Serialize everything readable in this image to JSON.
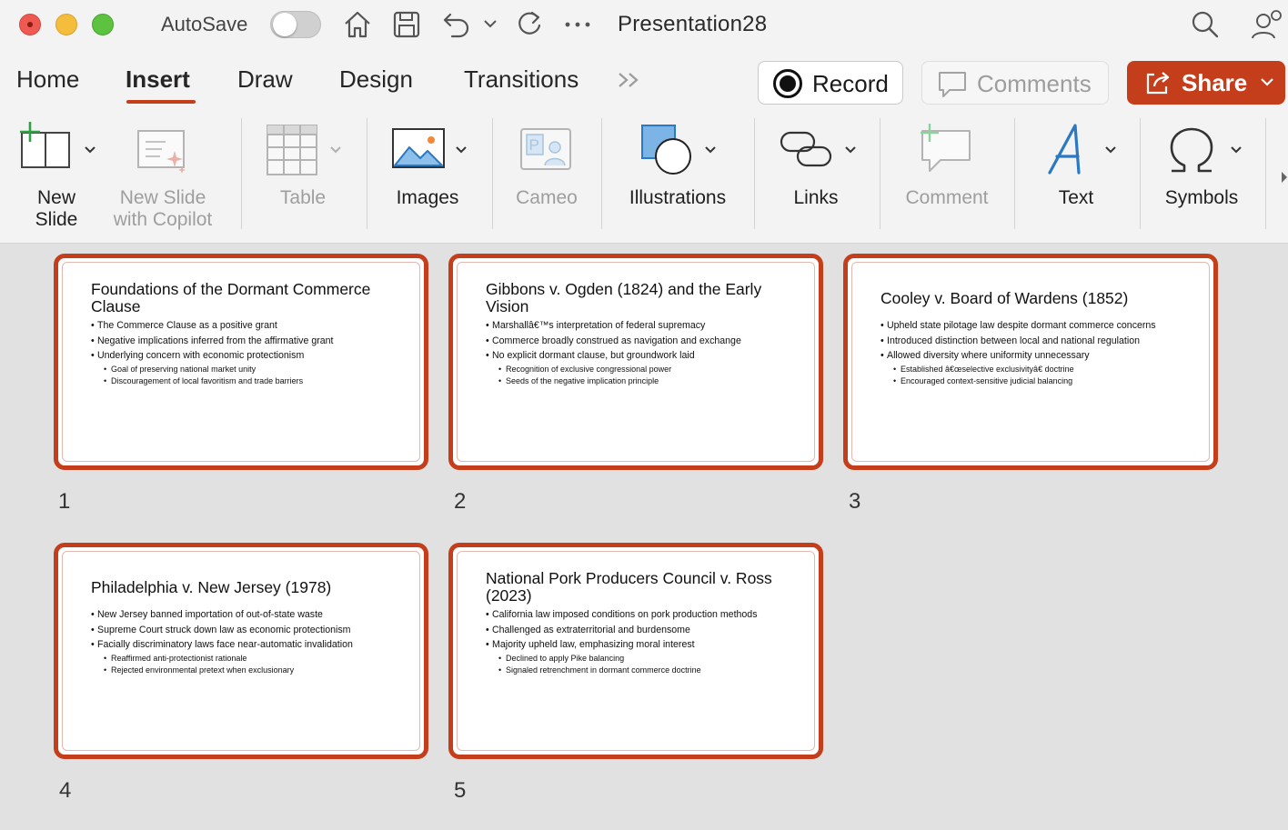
{
  "window": {
    "autosave_label": "AutoSave",
    "document_title": "Presentation28"
  },
  "tabs": [
    {
      "label": "Home"
    },
    {
      "label": "Insert",
      "active": true
    },
    {
      "label": "Draw"
    },
    {
      "label": "Design"
    },
    {
      "label": "Transitions"
    }
  ],
  "actions": {
    "record": "Record",
    "comments": "Comments",
    "share": "Share"
  },
  "ribbon": {
    "new_slide_line1": "New",
    "new_slide_line2": "Slide",
    "copilot_line1": "New Slide",
    "copilot_line2": "with Copilot",
    "table": "Table",
    "images": "Images",
    "cameo": "Cameo",
    "illustrations": "Illustrations",
    "links": "Links",
    "comment": "Comment",
    "text": "Text",
    "symbols": "Symbols"
  },
  "colors": {
    "accent": "#c43e1c",
    "ribbon_bg": "#f3f3f3",
    "canvas_bg": "#e1e1e1"
  },
  "slides": [
    {
      "number": "1",
      "title": "Foundations of the Dormant Commerce Clause",
      "bullets": [
        "The Commerce Clause as a positive grant",
        "Negative implications inferred from the affirmative grant",
        "Underlying concern with economic protectionism"
      ],
      "sub_bullets": [
        "Goal of preserving national market unity",
        "Discouragement of local favoritism and trade barriers"
      ]
    },
    {
      "number": "2",
      "title": "Gibbons v. Ogden (1824) and the Early Vision",
      "bullets": [
        "Marshallâ€™s interpretation of federal supremacy",
        "Commerce broadly construed as navigation and exchange",
        "No explicit dormant clause, but groundwork laid"
      ],
      "sub_bullets": [
        "Recognition of exclusive congressional power",
        "Seeds of the negative implication principle"
      ]
    },
    {
      "number": "3",
      "title": "Cooley v. Board of Wardens (1852)",
      "bullets": [
        "Upheld state pilotage law despite dormant commerce concerns",
        "Introduced distinction between local and national regulation",
        "Allowed diversity where uniformity unnecessary"
      ],
      "sub_bullets": [
        "Established â€œselective exclusivityâ€ doctrine",
        "Encouraged context-sensitive judicial balancing"
      ]
    },
    {
      "number": "4",
      "title": "Philadelphia v. New Jersey (1978)",
      "bullets": [
        "New Jersey banned importation of out-of-state waste",
        "Supreme Court struck down law as economic protectionism",
        "Facially discriminatory laws face near-automatic invalidation"
      ],
      "sub_bullets": [
        "Reaffirmed anti-protectionist rationale",
        "Rejected environmental pretext when exclusionary"
      ]
    },
    {
      "number": "5",
      "title": "National Pork Producers Council v. Ross (2023)",
      "bullets": [
        "California law imposed conditions on pork production methods",
        "Challenged as extraterritorial and burdensome",
        "Majority upheld law, emphasizing moral interest"
      ],
      "sub_bullets": [
        "Declined to apply Pike balancing",
        "Signaled retrenchment in dormant commerce doctrine"
      ]
    }
  ]
}
